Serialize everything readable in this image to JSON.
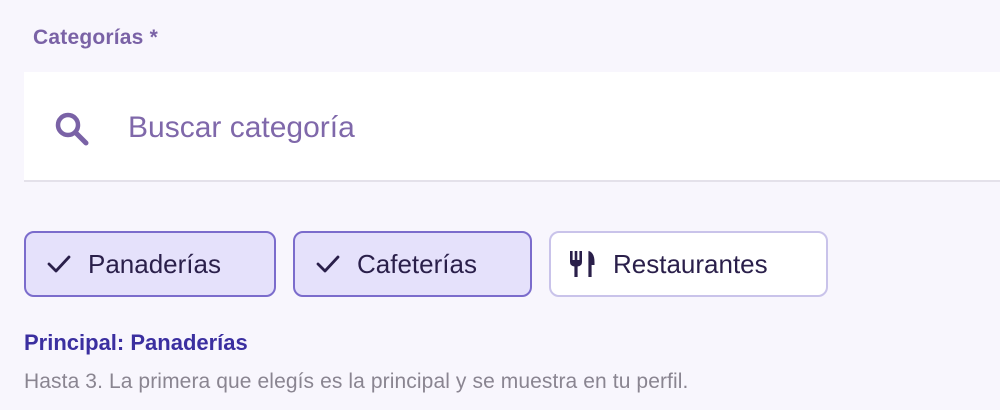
{
  "field": {
    "label": "Categorías *"
  },
  "search": {
    "placeholder": "Buscar categoría",
    "value": "",
    "icon": "search-icon"
  },
  "chips": [
    {
      "label": "Panaderías",
      "selected": true,
      "icon": "check-icon"
    },
    {
      "label": "Cafeterías",
      "selected": true,
      "icon": "check-icon"
    },
    {
      "label": "Restaurantes",
      "selected": false,
      "icon": "fork-knife-icon"
    }
  ],
  "principal": {
    "text": "Principal: Panaderías"
  },
  "helper": {
    "text": "Hasta 3. La primera que elegís es la principal y se muestra en tu perfil."
  },
  "colors": {
    "accent": "#7b6ccc",
    "label": "#7a62a6",
    "principal": "#3b2fa0",
    "chip_selected_bg": "#e5e1fb",
    "background": "#f8f6fd"
  }
}
